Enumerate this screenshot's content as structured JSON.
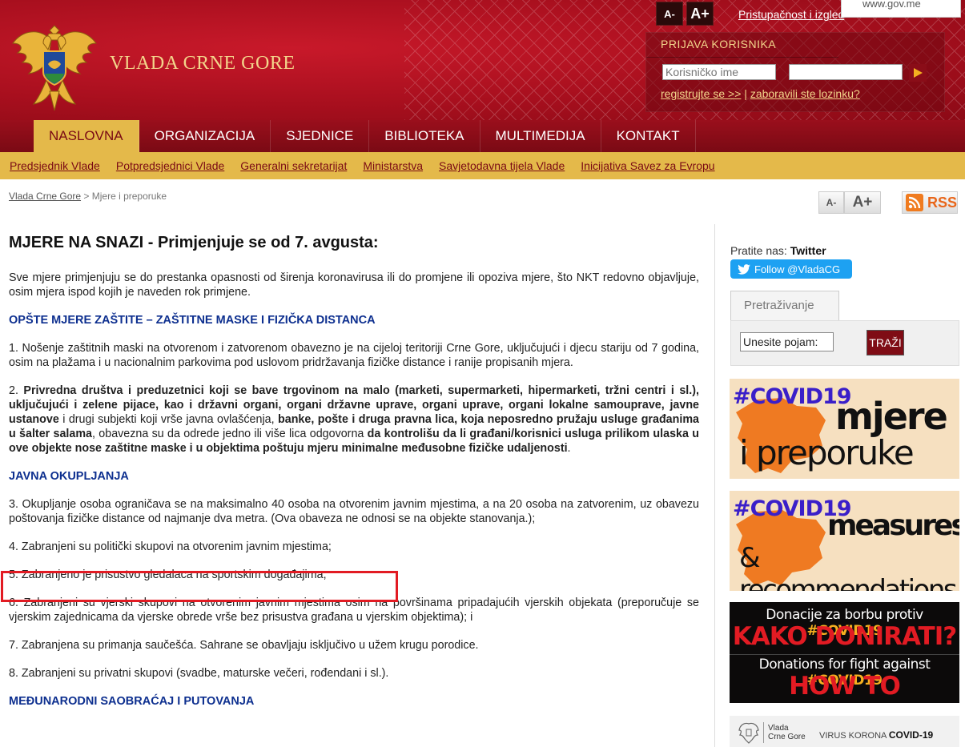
{
  "header": {
    "site_title": "VLADA CRNE GORE",
    "font_decrease": "A-",
    "font_increase": "A+",
    "accessibility_link": "Pristupačnost i izgled",
    "url_tooltip": "www.gov.me",
    "login": {
      "title": "PRIJAVA KORISNIKA",
      "username_placeholder": "Korisničko ime",
      "password_placeholder": "",
      "register_link": "registrujte se >>",
      "separator": "|",
      "forgot_link": "zaboravili ste lozinku?"
    }
  },
  "nav": {
    "items": [
      "NASLOVNA",
      "ORGANIZACIJA",
      "SJEDNICE",
      "BIBLIOTEKA",
      "MULTIMEDIJA",
      "KONTAKT"
    ],
    "active_index": 0
  },
  "subnav": {
    "items": [
      "Predsjednik Vlade",
      "Potpredsjednici Vlade",
      "Generalni sekretarijat",
      "Ministarstva",
      "Savjetodavna tijela Vlade",
      "Inicijativa Savez za Evropu"
    ]
  },
  "breadcrumb": {
    "home": "Vlada Crne Gore",
    "sep": " > ",
    "current": "Mjere i preporuke"
  },
  "tools": {
    "small": "A-",
    "big": "A+",
    "rss": "RSS"
  },
  "content": {
    "heading": "MJERE NA SNAZI - Primjenjuje se od 7. avgusta:",
    "intro": "Sve mjere primjenjuju se do prestanka opasnosti od širenja koronavirusa ili do promjene ili opoziva mjere, što NKT redovno objavljuje, osim mjera ispod kojih je naveden rok primjene.",
    "section1": "OPŠTE MJERE ZAŠTITE – ZAŠTITNE MASKE I FIZIČKA DISTANCA",
    "item1": "1.      Nošenje zaštitnih maski na otvorenom i zatvorenom obavezno je na cijeloj teritoriji Crne Gore, uključujući i djecu stariju od 7 godina, osim na plažama i u nacionalnim parkovima pod uslovom pridržavanja fizičke distance i ranije propisanih mjera.",
    "item2": {
      "num": "2. ",
      "b1": "Privredna društva i preduzetnici koji se bave trgovinom na malo (marketi, supermarketi, hipermarketi, tržni centri i sl.), uključujući i zelene pijace, kao i državni organi, organi državne uprave, organi uprave, organi lokalne samouprave, javne ustanove",
      "t1": " i drugi subjekti koji vrše javna ovlašćenja, ",
      "b2": "banke, pošte i druga pravna lica, koja neposredno pružaju usluge građanima u šalter salama",
      "t2": ", obavezna su da odrede jedno ili više lica odgovorna ",
      "b3": "da kontrolišu da li građani/korisnici usluga prilikom ulaska u ove objekte nose zaštitne maske i u objektima poštuju mjeru minimalne međusobne fizičke udaljenosti",
      "t3": "."
    },
    "section2": "JAVNA OKUPLJANJA",
    "item3": "3.     Okupljanje osoba ograničava se na maksimalno 40 osoba na otvorenim javnim mjestima, a na 20 osoba na zatvorenim, uz obavezu poštovanja fizičke distance od najmanje dva metra. (Ova obaveza ne odnosi se na objekte stanovanja.);",
    "item4": "4.      Zabranjeni su politički skupovi na otvorenim javnim mjestima;",
    "item5": "5.      Zabranjeno je prisustvo gledalaca na sportskim događajima;",
    "item6": "6.      Zabranjeni su vjerski skupovi na otvorenim javnim mjestima osim na površinama pripadajućih vjerskih objekata (preporučuje se vjerskim zajednicama da vjerske obrede vrše bez prisustva građana u vjerskim objektima); i",
    "item7": "7.      Zabranjena su primanja saučešća. Sahrane se obavljaju isključivo u užem krugu porodice.",
    "item8": "8.      Zabranjeni su privatni skupovi (svadbe, maturske večeri, rođendani i sl.).",
    "section3": "MEĐUNARODNI SAOBRAĆAJ I PUTOVANJA"
  },
  "sidebar": {
    "follow_label": "Pratite nas:",
    "follow_network": "Twitter",
    "twitter_button": "Follow @VladaCG",
    "search_tab": "Pretraživanje",
    "search_value": "Unesite pojam:",
    "search_button": "TRAŽI",
    "banner1": {
      "tag": "#COVID19",
      "big": "mjere",
      "small": "i preporuke"
    },
    "banner2": {
      "tag": "#COVID19",
      "big": "measures",
      "small": "& recommendations"
    },
    "banner3": {
      "line1": "Donacije za borbu protiv",
      "line2": "KAKO DONIRATI?",
      "line3": "Donations for fight against",
      "line4": "HOW TO DONATE?",
      "hashtag": "#COVID19"
    },
    "banner4": {
      "org_line1": "Vlada",
      "org_line2": "Crne Gore",
      "label": "VIRUS KORONA",
      "label_bold": "COVID-19"
    }
  },
  "colors": {
    "brand_red": "#a80f1e",
    "gold": "#e4b94a",
    "section_blue": "#0d2f8f",
    "highlight_red": "#e21b23",
    "twitter_blue": "#1da1f2"
  }
}
